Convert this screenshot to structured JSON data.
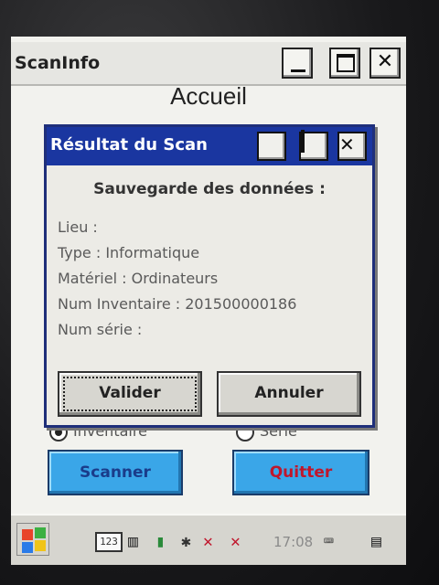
{
  "window": {
    "title": "ScanInfo",
    "close_glyph": "✕"
  },
  "page": {
    "heading": "Accueil"
  },
  "dialog": {
    "title": "Résultat du Scan",
    "close_glyph": "✕",
    "heading": "Sauvegarde des données :",
    "fields": [
      "Lieu :",
      "Type : Informatique",
      "Matériel : Ordinateurs",
      "Num Inventaire : 201500000186",
      "Num série :"
    ],
    "validate_label": "Valider",
    "cancel_label": "Annuler"
  },
  "options": {
    "inventaire_label": "Inventaire",
    "serie_label": "Série",
    "selected": "inventaire"
  },
  "actions": {
    "scan_label": "Scanner",
    "quit_label": "Quitter"
  },
  "taskbar": {
    "input_indicator": "123",
    "time": "17:08"
  },
  "colors": {
    "dialog_titlebar": "#1a36a0",
    "scanner_button": "#3aa6e8",
    "scanner_text": "#1a3c8a",
    "quit_text": "#c0162c"
  },
  "icons": [
    "windows-start-icon",
    "keyboard-123-icon",
    "barcode-icon",
    "battery-icon",
    "bluetooth-icon",
    "signal-off-icon",
    "network-off-icon",
    "keyboard-icon",
    "window-switch-icon"
  ]
}
